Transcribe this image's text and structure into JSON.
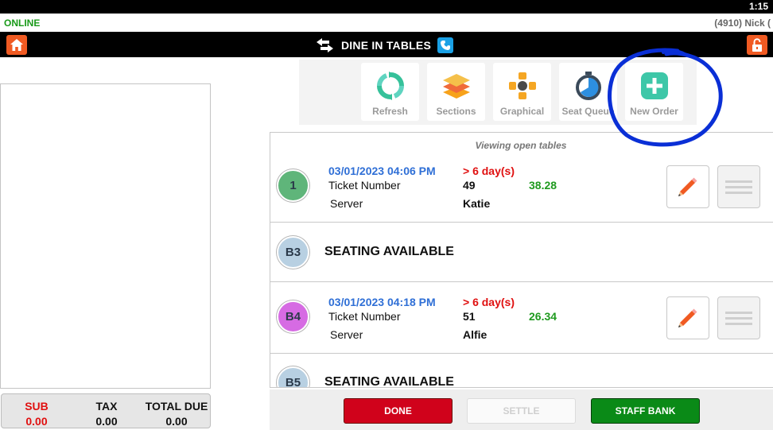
{
  "status_bar": {
    "time": "1:15"
  },
  "info_bar": {
    "status": "ONLINE",
    "user": "(4910) Nick ("
  },
  "title_bar": {
    "title": "DINE IN TABLES"
  },
  "toolbar": {
    "items": [
      {
        "label": "Refresh",
        "icon": "refresh-icon"
      },
      {
        "label": "Sections",
        "icon": "layers-icon"
      },
      {
        "label": "Graphical",
        "icon": "graphical-icon"
      },
      {
        "label": "Seat Queue",
        "icon": "timer-icon"
      },
      {
        "label": "New Order",
        "icon": "plus-icon"
      }
    ]
  },
  "tables": {
    "viewing_label": "Viewing open tables",
    "rows": [
      {
        "badge": "1",
        "date": "03/01/2023 04:06 PM",
        "overdue": "> 6 day(s)",
        "ticket_label": "Ticket Number",
        "ticket_number": "49",
        "amount": "38.28",
        "server_label": "Server",
        "server": "Katie"
      },
      {
        "badge": "B3",
        "seating": "SEATING AVAILABLE"
      },
      {
        "badge": "B4",
        "date": "03/01/2023 04:18 PM",
        "overdue": "> 6 day(s)",
        "ticket_label": "Ticket Number",
        "ticket_number": "51",
        "amount": "26.34",
        "server_label": "Server",
        "server": "Alfie"
      },
      {
        "badge": "B5",
        "seating": "SEATING AVAILABLE"
      }
    ]
  },
  "totals": {
    "sub_label": "SUB",
    "sub_value": "0.00",
    "tax_label": "TAX",
    "tax_value": "0.00",
    "due_label": "TOTAL DUE",
    "due_value": "0.00"
  },
  "footer": {
    "done": "DONE",
    "settle": "SETTLE",
    "staff_bank": "STAFF BANK"
  },
  "colors": {
    "accent_orange": "#f05a22",
    "annotation_blue": "#0a2fd6",
    "done_red": "#d0021b",
    "bank_green": "#0a8a17"
  }
}
